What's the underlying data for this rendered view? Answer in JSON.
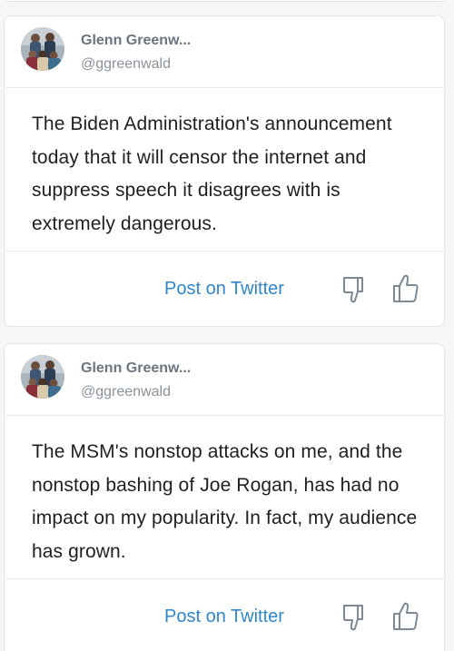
{
  "posts": [
    {
      "author": {
        "name": "Glenn Greenw...",
        "handle": "@ggreenwald"
      },
      "text": "The Biden Administration's announcement today that it will censor the internet and suppress speech it disagrees with is extremely dangerous.",
      "post_link_label": "Post on Twitter",
      "icons": {
        "down": "thumbs-down-icon",
        "up": "thumbs-up-icon"
      }
    },
    {
      "author": {
        "name": "Glenn Greenw...",
        "handle": "@ggreenwald"
      },
      "text": "The MSM's nonstop attacks on me, and the nonstop bashing of Joe Rogan, has had no impact on my popularity. In fact, my audience has grown.",
      "post_link_label": "Post on Twitter",
      "icons": {
        "down": "thumbs-down-icon",
        "up": "thumbs-up-icon"
      }
    }
  ],
  "colors": {
    "link": "#2f86c9",
    "icon": "#7d8a96",
    "border": "#e3e5e8"
  }
}
